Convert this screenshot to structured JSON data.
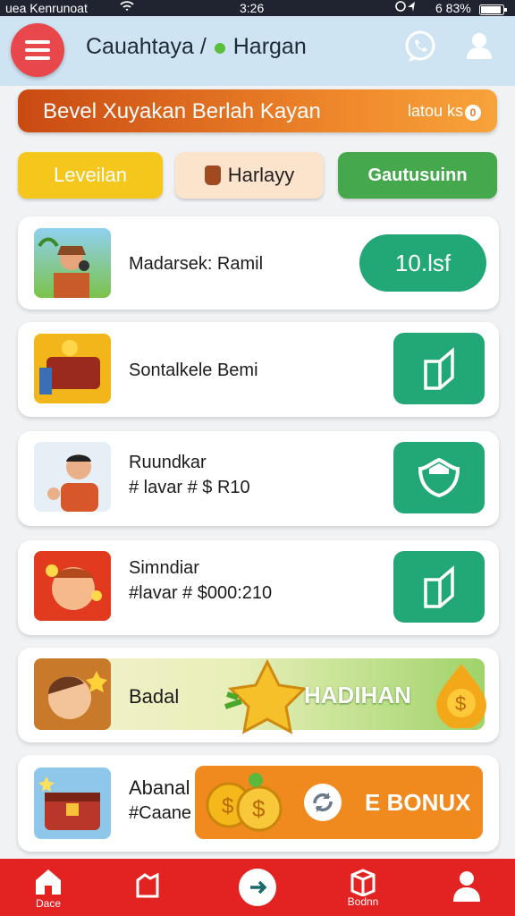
{
  "status_bar": {
    "carrier": "uea Kenrunoat",
    "time": "3:26",
    "battery": "6 83%"
  },
  "header": {
    "title": "Cauahtaya /",
    "title_end": "Hargan"
  },
  "banner": {
    "text": "Bevel Xuyakan Berlah Kayan",
    "right": "latou ks"
  },
  "filters": [
    "Leveilan",
    "Harlayy",
    "Gautusuinn"
  ],
  "tasks": [
    {
      "title": "Madarsek: Ramil",
      "button": "10.lsf"
    },
    {
      "title": "Sontalkele Bemi"
    },
    {
      "title": "Ruundkar",
      "subtitle": "# lavar # $ R10"
    },
    {
      "title": "Simndiar",
      "subtitle": "#lavar # $000:210"
    }
  ],
  "promo1": {
    "label": "Badal",
    "badge": "HADIHAN"
  },
  "promo2": {
    "title": "Abanal",
    "subtitle": "#Caane",
    "bonus": "E BONUX"
  },
  "nav": {
    "home": "Dace",
    "center": "",
    "profile_label": "Bodnn"
  },
  "colors": {
    "accent_red": "#e32222",
    "green": "#22a876",
    "orange": "#f08a2c"
  }
}
